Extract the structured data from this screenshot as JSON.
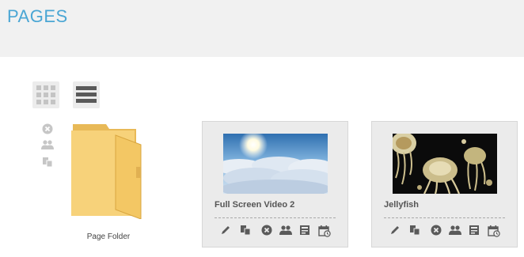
{
  "header": {
    "title": "PAGES"
  },
  "view_toggles": [
    {
      "name": "grid-view",
      "icon": "grid-icon",
      "active": false
    },
    {
      "name": "list-view",
      "icon": "list-icon",
      "active": true
    }
  ],
  "folder": {
    "label": "Page Folder",
    "actions": [
      "delete-icon",
      "users-icon",
      "copy-icon"
    ]
  },
  "pages": [
    {
      "title": "Full Screen Video 2",
      "thumbnail": "sky-clouds-thumbnail",
      "actions": [
        "edit-icon",
        "copy-icon",
        "delete-icon",
        "users-icon",
        "template-icon",
        "schedule-icon"
      ]
    },
    {
      "title": "Jellyfish",
      "thumbnail": "jellyfish-thumbnail",
      "actions": [
        "edit-icon",
        "copy-icon",
        "delete-icon",
        "users-icon",
        "template-icon",
        "schedule-icon"
      ]
    }
  ],
  "colors": {
    "title_blue": "#4aa6d4",
    "header_bg": "#f1f1f1",
    "card_bg": "#ebebeb",
    "folder_yellow": "#f7d27a",
    "icon_gray": "#5a5a5a"
  }
}
